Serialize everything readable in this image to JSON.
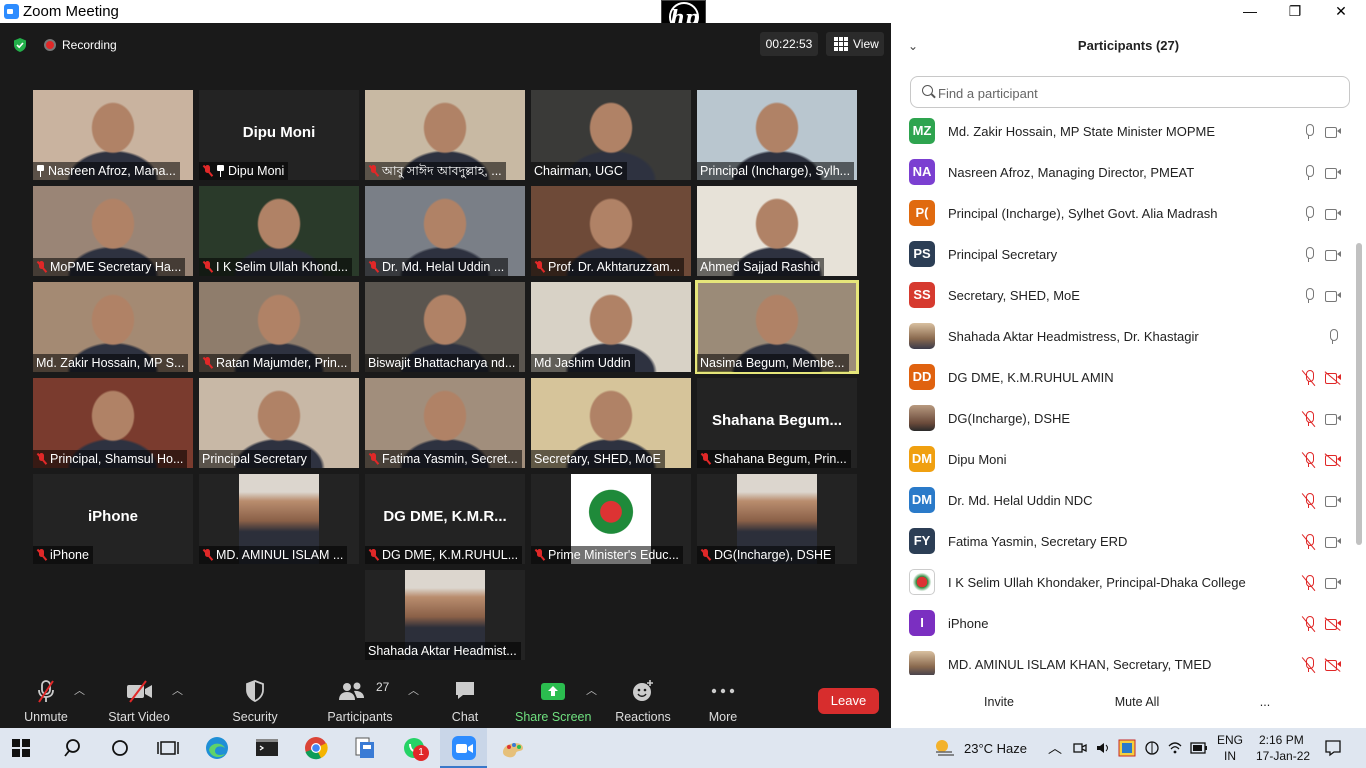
{
  "window": {
    "title": "Zoom Meeting",
    "minimize": "—",
    "restore": "❐",
    "close": "✕",
    "hp_logo": "hp"
  },
  "status": {
    "recording": "Recording",
    "timer": "00:22:53",
    "view_label": "View"
  },
  "tiles": [
    {
      "label": "Nasreen Afroz, Mana...",
      "pinned": true,
      "muted": false,
      "bg": "#c9b39f",
      "video": true
    },
    {
      "label": "Dipu Moni",
      "pinned": true,
      "muted": true,
      "bg": "#232323",
      "video": false,
      "center_name": "Dipu Moni"
    },
    {
      "label": "আবু সাঈদ আবদুল্লাহ, ...",
      "muted": true,
      "bg": "#c8b9a3",
      "video": true
    },
    {
      "label": "Chairman, UGC",
      "muted": false,
      "bg": "#3a3a38",
      "video": true
    },
    {
      "label": "Principal (Incharge), Sylh...",
      "muted": false,
      "bg": "#b9c6cf",
      "video": true
    },
    {
      "label": "MoPME Secretary Ha...",
      "muted": true,
      "bg": "#9a8576",
      "video": true
    },
    {
      "label": "I K Selim Ullah Khond...",
      "muted": true,
      "bg": "#2a3a2a",
      "video": true
    },
    {
      "label": "Dr. Md. Helal Uddin ...",
      "muted": true,
      "bg": "#7a7f87",
      "video": true
    },
    {
      "label": "Prof. Dr. Akhtaruzzam...",
      "muted": true,
      "bg": "#6e4a38",
      "video": true
    },
    {
      "label": "Ahmed Sajjad Rashid",
      "muted": false,
      "bg": "#e7e2d8",
      "video": true
    },
    {
      "label": "Md. Zakir Hossain, MP S...",
      "muted": false,
      "bg": "#a48a73",
      "video": true
    },
    {
      "label": "Ratan Majumder, Prin...",
      "muted": true,
      "bg": "#8f7d6c",
      "video": true
    },
    {
      "label": "Biswajit Bhattacharya nd...",
      "muted": false,
      "bg": "#5a554f",
      "video": true
    },
    {
      "label": "Md Jashim Uddin",
      "muted": false,
      "bg": "#d8d2c6",
      "video": true
    },
    {
      "label": "Nasima Begum, Membe...",
      "muted": false,
      "bg": "#9b8b78",
      "video": true,
      "active": true
    },
    {
      "label": "Principal, Shamsul Ho...",
      "muted": true,
      "bg": "#7a3b2e",
      "video": true
    },
    {
      "label": "Principal Secretary",
      "muted": false,
      "bg": "#c8b8a6",
      "video": true
    },
    {
      "label": "Fatima Yasmin, Secret...",
      "muted": true,
      "bg": "#a18e7c",
      "video": true
    },
    {
      "label": "Secretary, SHED, MoE",
      "muted": false,
      "bg": "#d6c49a",
      "video": true
    },
    {
      "label": "Shahana Begum,  Prin...",
      "muted": true,
      "bg": "#232323",
      "video": false,
      "center_name": "Shahana  Begum..."
    },
    {
      "label": "iPhone",
      "muted": true,
      "bg": "#232323",
      "video": false,
      "center_name": "iPhone"
    },
    {
      "label": "MD. AMINUL ISLAM ...",
      "muted": true,
      "bg": "#232323",
      "video": true,
      "portrait": true
    },
    {
      "label": "DG DME, K.M.RUHUL...",
      "muted": true,
      "bg": "#232323",
      "video": false,
      "center_name": "DG  DME,  K.M.R..."
    },
    {
      "label": "Prime Minister's Educ...",
      "muted": true,
      "bg": "#232323",
      "video": true,
      "portrait": true,
      "emblem": true
    },
    {
      "label": "DG(Incharge), DSHE",
      "muted": true,
      "bg": "#232323",
      "video": true,
      "portrait": true
    },
    {
      "label": "Shahada Aktar Headmist...",
      "muted": false,
      "bg": "#232323",
      "video": true,
      "portrait": true
    }
  ],
  "toolbar": {
    "unmute": "Unmute",
    "start_video": "Start Video",
    "security": "Security",
    "participants": "Participants",
    "participants_count": "27",
    "chat": "Chat",
    "share_screen": "Share Screen",
    "reactions": "Reactions",
    "more": "More",
    "leave": "Leave"
  },
  "panel": {
    "title": "Participants (27)",
    "search_placeholder": "Find a participant",
    "invite": "Invite",
    "mute_all": "Mute All",
    "more": "...",
    "participants": [
      {
        "initials": "MZ",
        "name": "Md. Zakir Hossain, MP State Minister MOPME",
        "color": "#2ea44f",
        "mic": "on",
        "cam": "on"
      },
      {
        "initials": "NA",
        "name": "Nasreen Afroz, Managing Director, PMEAT",
        "color": "#7b3fd1",
        "mic": "on",
        "cam": "on"
      },
      {
        "initials": "P(",
        "name": "Principal (Incharge), Sylhet Govt. Alia Madrash",
        "color": "#e06a0f",
        "mic": "on",
        "cam": "on"
      },
      {
        "initials": "PS",
        "name": "Principal Secretary",
        "color": "#2c3e55",
        "mic": "on",
        "cam": "on"
      },
      {
        "initials": "SS",
        "name": "Secretary, SHED, MoE",
        "color": "#d63a2f",
        "mic": "on",
        "cam": "on"
      },
      {
        "initials": "",
        "name": "Shahada Aktar Headmistress, Dr. Khastagir",
        "color": "",
        "photo": "photo",
        "mic": "on",
        "cam": "none"
      },
      {
        "initials": "DD",
        "name": "DG DME, K.M.RUHUL AMIN",
        "color": "#e0620f",
        "mic": "off",
        "cam": "off"
      },
      {
        "initials": "",
        "name": "DG(Incharge), DSHE",
        "color": "",
        "photo": "photo2",
        "mic": "off",
        "cam": "on"
      },
      {
        "initials": "DM",
        "name": "Dipu Moni",
        "color": "#f0a010",
        "mic": "off",
        "cam": "off"
      },
      {
        "initials": "DM",
        "name": "Dr. Md. Helal Uddin NDC",
        "color": "#2a7ac9",
        "mic": "off",
        "cam": "on"
      },
      {
        "initials": "FY",
        "name": "Fatima Yasmin, Secretary ERD",
        "color": "#2c3e55",
        "mic": "off",
        "cam": "on"
      },
      {
        "initials": "",
        "name": "I K Selim Ullah Khondaker, Principal-Dhaka College",
        "color": "",
        "photo": "emblem",
        "mic": "off",
        "cam": "on"
      },
      {
        "initials": "I",
        "name": "iPhone",
        "color": "#7b2fc1",
        "mic": "off",
        "cam": "off"
      },
      {
        "initials": "",
        "name": "MD. AMINUL ISLAM KHAN, Secretary, TMED",
        "color": "",
        "photo": "photo",
        "mic": "off",
        "cam": "off"
      }
    ]
  },
  "taskbar": {
    "weather": "23°C  Haze",
    "lang_top": "ENG",
    "lang_bottom": "IN",
    "time": "2:16 PM",
    "date": "17-Jan-22",
    "whatsapp_badge": "1"
  }
}
